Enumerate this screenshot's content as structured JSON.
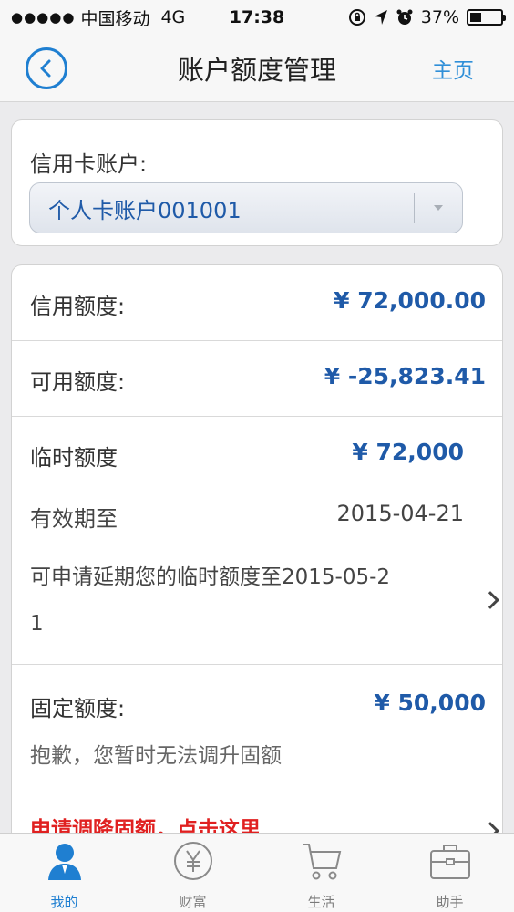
{
  "status_bar": {
    "signal": "●●●●●",
    "carrier": "中国移动",
    "network": "4G",
    "time": "17:38",
    "battery_percent": "37%",
    "battery_level": 0.37
  },
  "nav": {
    "title": "账户额度管理",
    "home": "主页"
  },
  "account": {
    "label": "信用卡账户:",
    "selected": "个人卡账户001001"
  },
  "limits": {
    "credit_label": "信用额度:",
    "credit_value": "¥ 72,000.00",
    "available_label": "可用额度:",
    "available_value": "¥ -25,823.41",
    "temp_label": "临时额度",
    "temp_value": "¥ 72,000",
    "valid_label": "有效期至",
    "valid_value": "2015-04-21",
    "extend_line1": "可申请延期您的临时额度至2015-05-2",
    "extend_line2": "1",
    "fixed_label": "固定额度:",
    "fixed_value": "¥ 50,000",
    "fixed_note": "抱歉，您暂时无法调升固额",
    "fixed_action": "申请调降固额，点击这里"
  },
  "tabs": [
    {
      "label": "我的",
      "icon": "user-icon",
      "active": true
    },
    {
      "label": "财富",
      "icon": "yuan-icon",
      "active": false
    },
    {
      "label": "生活",
      "icon": "cart-icon",
      "active": false
    },
    {
      "label": "助手",
      "icon": "briefcase-icon",
      "active": false
    }
  ],
  "colors": {
    "accent": "#1f7fd1",
    "value_blue": "#1f5aa8",
    "alert_red": "#e02020"
  }
}
